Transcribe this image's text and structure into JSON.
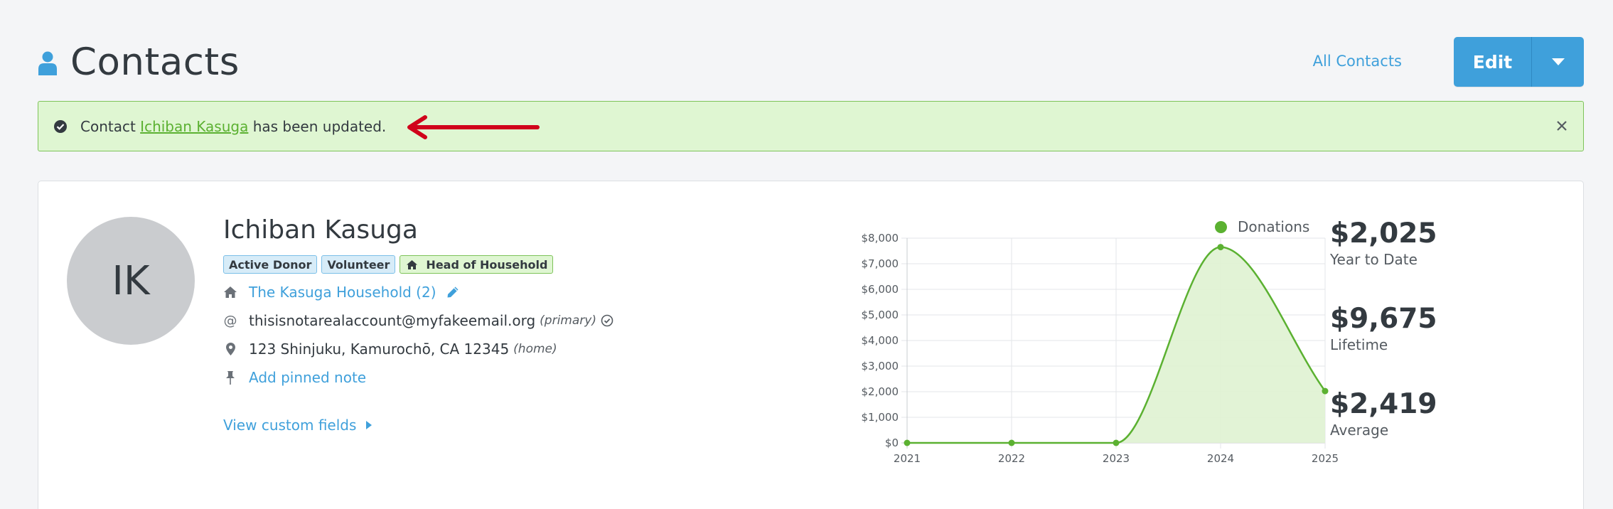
{
  "header": {
    "title": "Contacts",
    "all_contacts_link": "All Contacts",
    "edit_label": "Edit"
  },
  "alert": {
    "prefix": "Contact ",
    "contact_link": "Ichiban Kasuga",
    "suffix": " has been updated."
  },
  "contact": {
    "initials": "IK",
    "name": "Ichiban Kasuga",
    "tags": [
      {
        "label": "Active Donor",
        "style": "blue"
      },
      {
        "label": "Volunteer",
        "style": "blue"
      },
      {
        "label": "Head of Household",
        "style": "green",
        "icon": "home-icon"
      }
    ],
    "household": "The Kasuga Household (2)",
    "email": "thisisnotarealaccount@myfakeemail.org",
    "email_note": "(primary)",
    "address": "123 Shinjuku, Kamurochō, CA 12345",
    "address_note": "(home)",
    "pinned_note_link": "Add pinned note",
    "custom_fields_link": "View custom fields"
  },
  "stats": [
    {
      "value": "$2,025",
      "label": "Year to Date"
    },
    {
      "value": "$9,675",
      "label": "Lifetime"
    },
    {
      "value": "$2,419",
      "label": "Average"
    }
  ],
  "colors": {
    "accent": "#3fa0db",
    "success": "#5bb131",
    "success_bg": "#dff6d2",
    "arrow": "#d0021b"
  },
  "chart_data": {
    "type": "area",
    "x": [
      "2021",
      "2022",
      "2023",
      "2024",
      "2025"
    ],
    "series": [
      {
        "name": "Donations",
        "values": [
          0,
          0,
          0,
          7650,
          2025
        ]
      }
    ],
    "ylim": [
      0,
      8000
    ],
    "yticks": [
      0,
      1000,
      2000,
      3000,
      4000,
      5000,
      6000,
      7000,
      8000
    ],
    "ytick_labels": [
      "$0",
      "$1,000",
      "$2,000",
      "$3,000",
      "$4,000",
      "$5,000",
      "$6,000",
      "$7,000",
      "$8,000"
    ],
    "grid": true,
    "legend": "top-right",
    "color": "#5bb131",
    "fill": "#dff2d1"
  }
}
